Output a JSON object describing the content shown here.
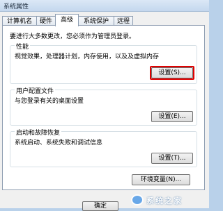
{
  "window": {
    "title": "系统属性"
  },
  "tabs": [
    {
      "label": "计算机名"
    },
    {
      "label": "硬件"
    },
    {
      "label": "高级",
      "active": true
    },
    {
      "label": "系统保护"
    },
    {
      "label": "远程"
    }
  ],
  "panel": {
    "notice": "要进行大多数更改，您必须作为管理员登录。",
    "performance": {
      "title": "性能",
      "description": "视觉效果，处理器计划，内存使用，以及及虚拟内存",
      "button": "设置(S)..."
    },
    "user_profiles": {
      "title": "用户配置文件",
      "description": "与您登录有关的桌面设置",
      "button": "设置(E)..."
    },
    "startup_recovery": {
      "title": "启动和故障恢复",
      "description": "系统启动、系统失败和调试信息",
      "button": "设置(T)..."
    },
    "env_button": "环境变量(N)..."
  },
  "footer": {
    "ok": "确定",
    "watermark": "系统之家"
  },
  "colors": {
    "highlight": "#e10000",
    "accent": "#3a6ea5"
  }
}
